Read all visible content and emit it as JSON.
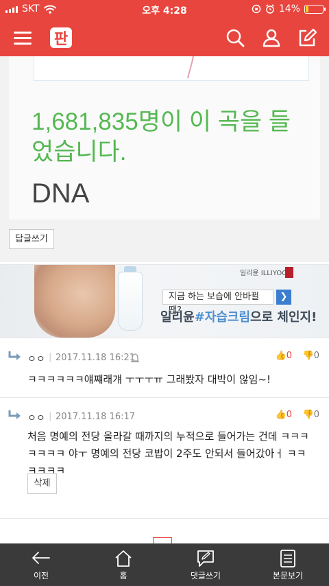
{
  "status_bar": {
    "carrier": "SKT",
    "time": "오후 4:28",
    "battery": "14%",
    "battery_level": 0.14
  },
  "header": {
    "logo_text": "판",
    "icons": [
      "hamburger-icon",
      "search-icon",
      "user-icon",
      "edit-icon"
    ]
  },
  "post_image": {
    "listen_text": "1,681,835명이 이 곡을 들었습니다.",
    "song_title": "DNA"
  },
  "reply_button": "답글쓰기",
  "ad": {
    "brand": "일리윤 ILLIYOON",
    "line1": "지금 하는 보습에 안바뀔 땐?",
    "line2_prefix": "일리윤",
    "line2_highlight": "#자습크림",
    "line2_suffix": "으로 체인지!"
  },
  "comments": [
    {
      "author": "ㅇㅇ",
      "date": "2017.11.18 16:21",
      "up": "0",
      "down": "0",
      "text": "ㅋㅋㅋㅋㅋㅋ얘쨰래걔 ㅜㅜㅜㅠ 그래봤자 대박이 않임~!"
    },
    {
      "author": "ㅇㅇ",
      "date": "2017.11.18 16:17",
      "up": "0",
      "down": "0",
      "text": "처음 명예의 전당 올라갈 때까지의 누적으로 들어가는 건데 ㅋㅋㅋㅋㅋㅋㅋ 야ㅜ 명예의 전당 코밥이 2주도 안되서 들어갔아ㅓ ㅋㅋㅋㅋㅋㅋ",
      "delete_label": "삭제"
    }
  ],
  "bottom_nav": [
    {
      "label": "이전",
      "icon": "back-arrow-icon"
    },
    {
      "label": "홈",
      "icon": "home-icon"
    },
    {
      "label": "댓글쓰기",
      "icon": "write-comment-icon"
    },
    {
      "label": "본문보기",
      "icon": "article-icon"
    }
  ]
}
